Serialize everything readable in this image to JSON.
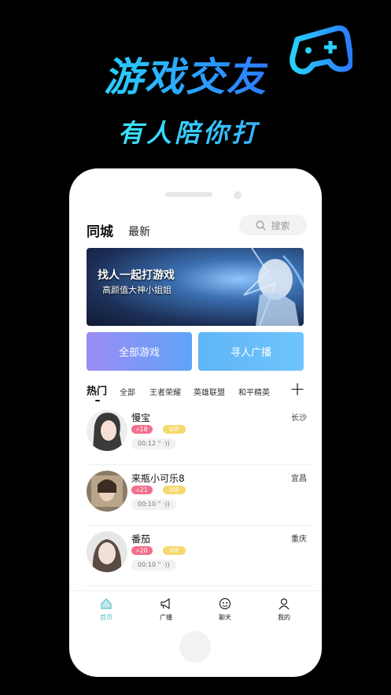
{
  "promo": {
    "title": "游戏交友",
    "subtitle": "有人陪你打"
  },
  "header": {
    "tab_city": "同城",
    "tab_new": "最新",
    "search_placeholder": "搜索"
  },
  "banner": {
    "title": "找人一起打游戏",
    "subtitle": "高颜值大神小姐姐"
  },
  "actions": {
    "all_games": "全部游戏",
    "find_broadcast": "寻人广播"
  },
  "categories": {
    "hot": "热门",
    "items": [
      "全部",
      "王者荣耀",
      "英雄联盟",
      "和平精英"
    ]
  },
  "users": [
    {
      "name": "慢宝",
      "city": "长沙",
      "count": "18",
      "vip": "VIP",
      "voice": "00:12 \""
    },
    {
      "name": "来瓶小可乐8",
      "city": "宜昌",
      "count": "21",
      "vip": "VIP",
      "voice": "00:10 \""
    },
    {
      "name": "番茄",
      "city": "重庆",
      "count": "20",
      "vip": "VIP",
      "voice": "00:10 \""
    }
  ],
  "tabbar": {
    "home": "首页",
    "broadcast": "广播",
    "chat": "聊天",
    "mine": "我的"
  },
  "colors": {
    "accent": "#58c3c6",
    "pink": "#f36f8c",
    "vip": "#f6d86d"
  }
}
